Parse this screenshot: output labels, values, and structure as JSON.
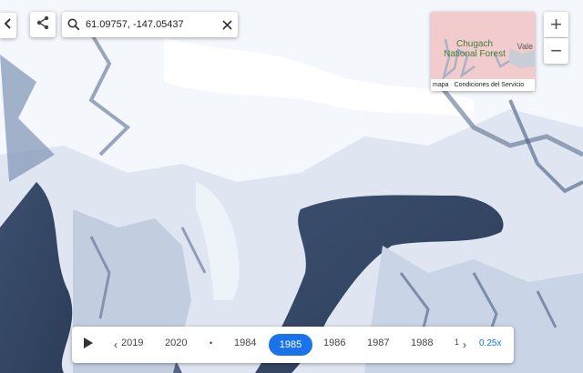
{
  "search": {
    "query": "61.09757, -147.05437"
  },
  "minimap": {
    "place_line1": "Chugach",
    "place_line2": "National Forest",
    "edge_label": "Vale",
    "footer_map": "mapa",
    "footer_terms": "Condiciones del Servicio",
    "forest_color": "#f2cccc"
  },
  "zoom": {
    "in_label": "+",
    "out_label": "−"
  },
  "timeline": {
    "years": [
      "2019",
      "2020",
      "•",
      "1984",
      "1985",
      "1986",
      "1987",
      "1988",
      "1"
    ],
    "selected_year": "1985",
    "speed": "0.25x",
    "accent": "#1a73e8"
  },
  "icons": [
    "chevron-left-icon",
    "share-icon",
    "search-icon",
    "close-icon",
    "play-icon",
    "chevron-right-icon"
  ]
}
